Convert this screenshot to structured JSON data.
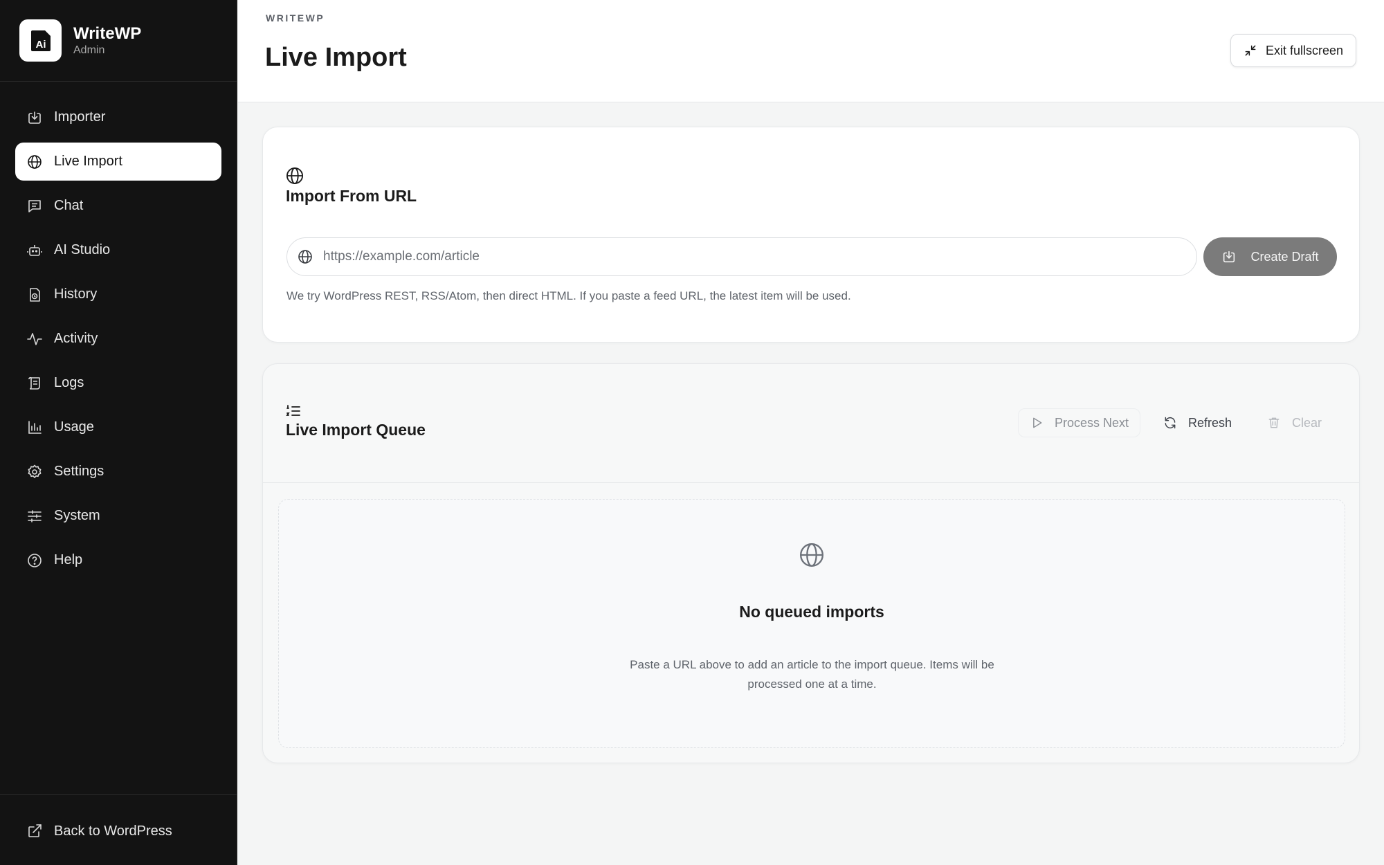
{
  "brand": {
    "logo_text": "Ai",
    "name": "WriteWP",
    "subtitle": "Admin"
  },
  "sidebar": {
    "items": [
      {
        "label": "Importer",
        "icon": "import-icon",
        "active": false
      },
      {
        "label": "Live Import",
        "icon": "globe-icon",
        "active": true
      },
      {
        "label": "Chat",
        "icon": "chat-icon",
        "active": false
      },
      {
        "label": "AI Studio",
        "icon": "bot-icon",
        "active": false
      },
      {
        "label": "History",
        "icon": "history-icon",
        "active": false
      },
      {
        "label": "Activity",
        "icon": "activity-icon",
        "active": false
      },
      {
        "label": "Logs",
        "icon": "scroll-icon",
        "active": false
      },
      {
        "label": "Usage",
        "icon": "bar-chart-icon",
        "active": false
      },
      {
        "label": "Settings",
        "icon": "gear-icon",
        "active": false
      },
      {
        "label": "System",
        "icon": "sliders-icon",
        "active": false
      },
      {
        "label": "Help",
        "icon": "help-icon",
        "active": false
      }
    ],
    "footer_link": "Back to WordPress"
  },
  "header": {
    "eyebrow": "WRITEWP",
    "title": "Live Import",
    "exit_label": "Exit fullscreen"
  },
  "url_import": {
    "title": "Import From URL",
    "input_value": "",
    "placeholder": "https://example.com/article",
    "create_label": "Create Draft",
    "hint": "We try WordPress REST, RSS/Atom, then direct HTML. If you paste a feed URL, the latest item will be used."
  },
  "queue": {
    "title": "Live Import Queue",
    "process_label": "Process Next",
    "refresh_label": "Refresh",
    "clear_label": "Clear",
    "empty_title": "No queued imports",
    "empty_text": "Paste a URL above to add an article to the import queue. Items will be processed one at a time."
  },
  "colors": {
    "sidebar_bg": "#131313",
    "active_item_bg": "#ffffff",
    "create_button_bg": "#7b7b7b",
    "page_bg": "#f4f5f5"
  }
}
